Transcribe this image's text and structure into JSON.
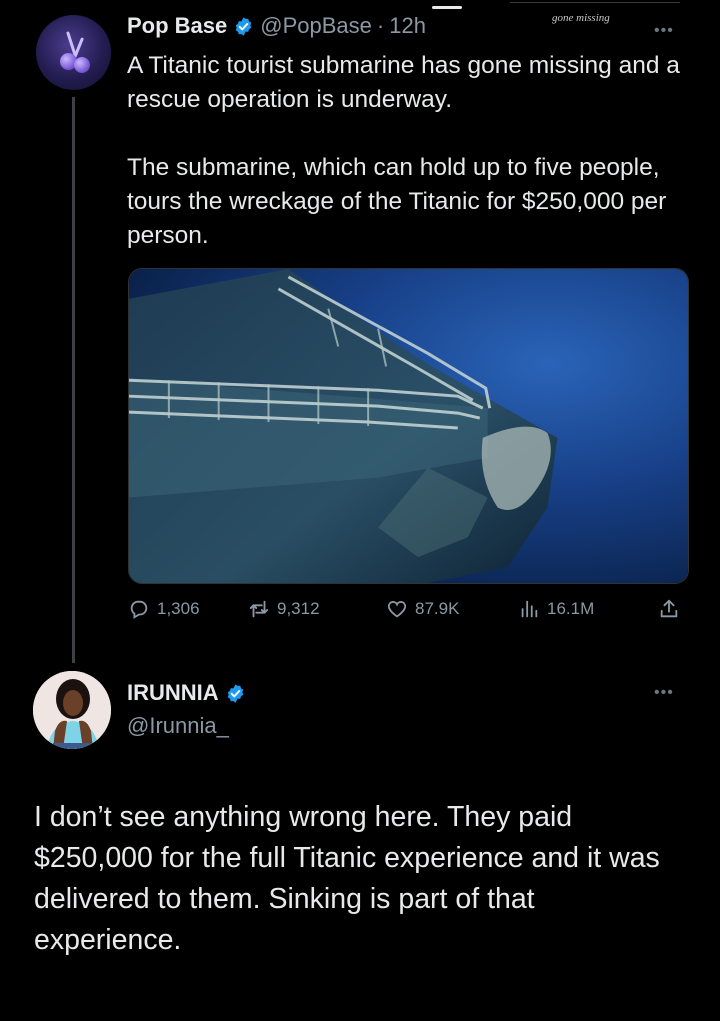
{
  "stray_caption": "gone missing",
  "tweet": {
    "display_name": "Pop Base",
    "handle": "@PopBase",
    "separator": "·",
    "time": "12h",
    "paragraph_1": "A Titanic tourist submarine has gone missing and a rescue operation is underway.",
    "paragraph_2": "The submarine, which can hold up to five people, tours the wreckage of the Titanic for $250,000 per person.",
    "media_icon": "titanic-wreck-photo",
    "actions": {
      "replies": "1,306",
      "retweets": "9,312",
      "likes": "87.9K",
      "views": "16.1M"
    }
  },
  "reply": {
    "display_name": "IRUNNIA",
    "handle": "@Irunnia_",
    "text": "I don’t see anything wrong here. They paid $250,000 for the full Titanic experience and it was delivered to them. Sinking is part of that experience."
  },
  "icons": [
    "verified-badge-icon",
    "more-icon",
    "reply-icon",
    "retweet-icon",
    "like-icon",
    "views-icon",
    "share-icon"
  ],
  "colors": {
    "background": "#000000",
    "text": "#e7e9ea",
    "secondary_text": "#8b98a5",
    "verified": "#1d9bf0",
    "ocean": "#1f4f9a"
  }
}
